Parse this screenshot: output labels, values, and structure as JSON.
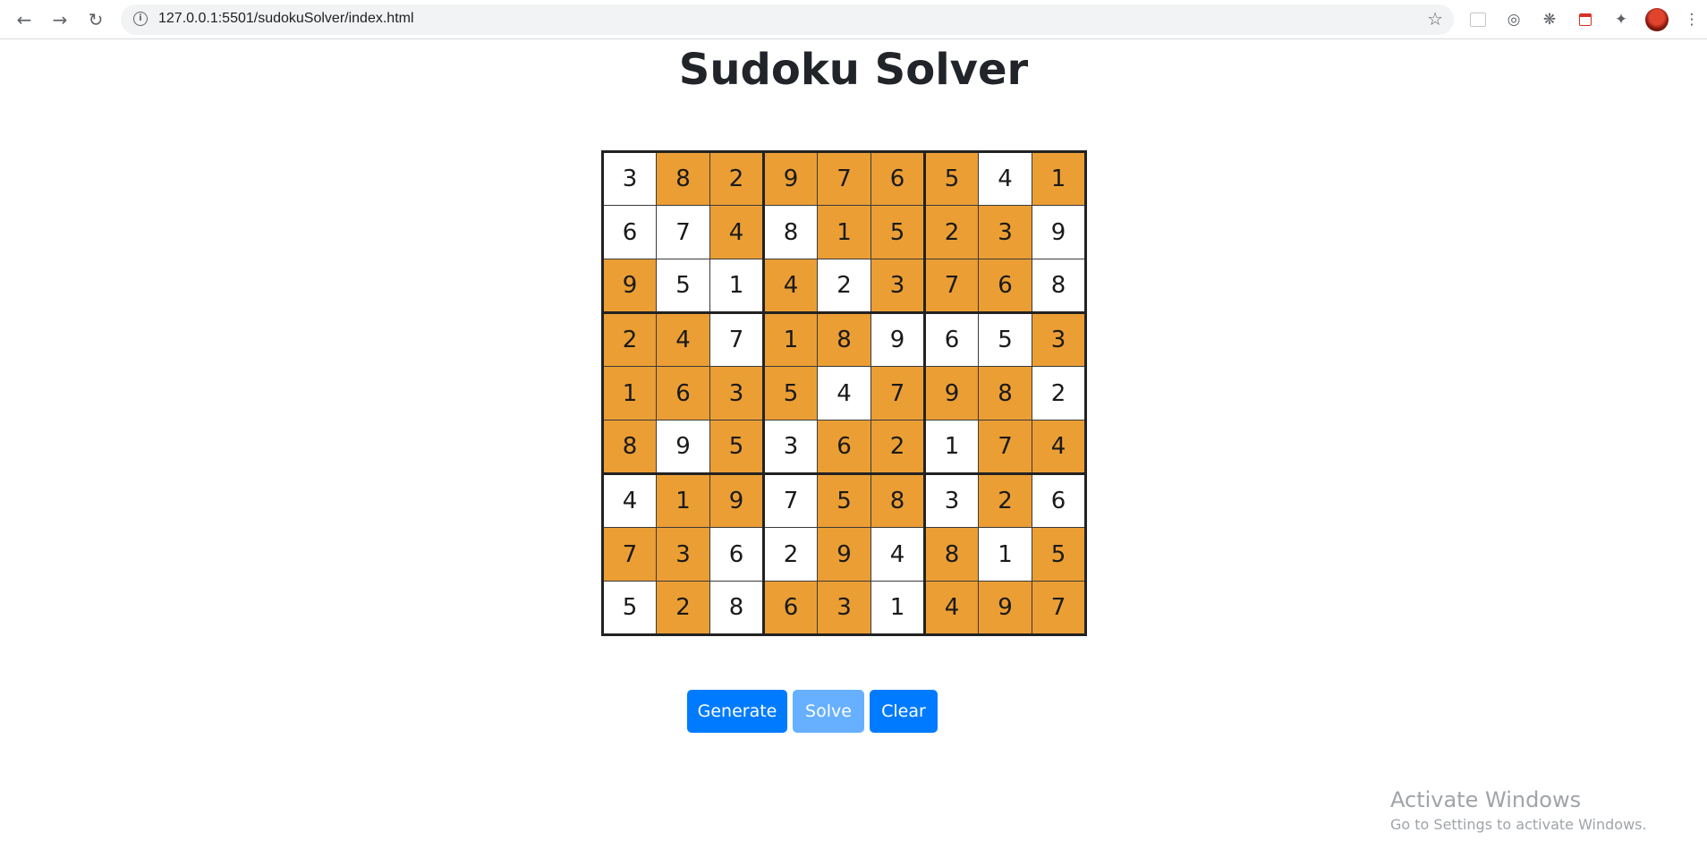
{
  "browser": {
    "url": "127.0.0.1:5501/sudokuSolver/index.html",
    "icons": [
      "back-arrow-icon",
      "forward-arrow-icon",
      "reload-icon",
      "info-icon",
      "star-icon",
      "extension-puzzle-icon",
      "more-vert-icon"
    ]
  },
  "page": {
    "title": "Sudoku Solver"
  },
  "sudoku": {
    "rows": [
      [
        "3",
        "8",
        "2",
        "9",
        "7",
        "6",
        "5",
        "4",
        "1"
      ],
      [
        "6",
        "7",
        "4",
        "8",
        "1",
        "5",
        "2",
        "3",
        "9"
      ],
      [
        "9",
        "5",
        "1",
        "4",
        "2",
        "3",
        "7",
        "6",
        "8"
      ],
      [
        "2",
        "4",
        "7",
        "1",
        "8",
        "9",
        "6",
        "5",
        "3"
      ],
      [
        "1",
        "6",
        "3",
        "5",
        "4",
        "7",
        "9",
        "8",
        "2"
      ],
      [
        "8",
        "9",
        "5",
        "3",
        "6",
        "2",
        "1",
        "7",
        "4"
      ],
      [
        "4",
        "1",
        "9",
        "7",
        "5",
        "8",
        "3",
        "2",
        "6"
      ],
      [
        "7",
        "3",
        "6",
        "2",
        "9",
        "4",
        "8",
        "1",
        "5"
      ],
      [
        "5",
        "2",
        "8",
        "6",
        "3",
        "1",
        "4",
        "9",
        "7"
      ]
    ],
    "filled": [
      [
        0,
        1,
        1,
        1,
        1,
        1,
        1,
        0,
        1
      ],
      [
        0,
        0,
        1,
        0,
        1,
        1,
        1,
        1,
        0
      ],
      [
        1,
        0,
        0,
        1,
        0,
        1,
        1,
        1,
        0
      ],
      [
        1,
        1,
        0,
        1,
        1,
        0,
        0,
        0,
        1
      ],
      [
        1,
        1,
        1,
        1,
        0,
        1,
        1,
        1,
        0
      ],
      [
        1,
        0,
        1,
        0,
        1,
        1,
        0,
        1,
        1
      ],
      [
        0,
        1,
        1,
        0,
        1,
        1,
        0,
        1,
        0
      ],
      [
        1,
        1,
        0,
        0,
        1,
        0,
        1,
        0,
        1
      ],
      [
        0,
        1,
        0,
        1,
        1,
        0,
        1,
        1,
        1
      ]
    ]
  },
  "buttons": {
    "generate": "Generate",
    "solve": "Solve",
    "clear": "Clear"
  },
  "watermark": {
    "title": "Activate Windows",
    "subtitle": "Go to Settings to activate Windows."
  },
  "colors": {
    "filled_cell": "#eb9e34",
    "empty_cell": "#ffffff",
    "button_primary": "#007bff",
    "button_disabled": "#66b0ff"
  }
}
